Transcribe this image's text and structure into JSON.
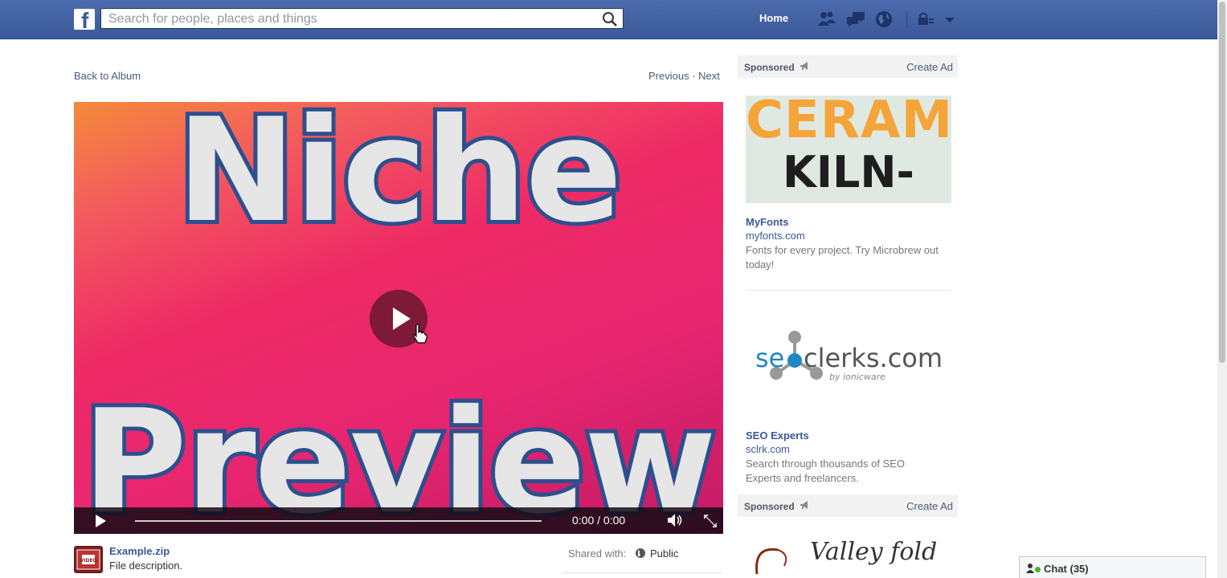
{
  "topbar": {
    "logo": "f",
    "search_placeholder": "Search for people, places and things",
    "home_label": "Home",
    "icons": [
      "friend-requests-icon",
      "messages-icon",
      "notifications-globe-icon",
      "privacy-shortcuts-icon",
      "account-dropdown-icon"
    ]
  },
  "nav": {
    "back_to_album": "Back to Album",
    "previous": "Previous",
    "separator": "·",
    "next": "Next"
  },
  "video": {
    "title_line_1": "Niche",
    "title_line_2": "Preview",
    "time": "0:00 / 0:00",
    "colors": {
      "outline": "#2d4f8e",
      "fill": "#e6e6e6"
    }
  },
  "file": {
    "name": "Example.zip",
    "description": "File description.",
    "shared_label": "Shared with:",
    "shared_value": "Public",
    "icon_label": "VIDEO"
  },
  "ads": {
    "header_1": {
      "label": "Sponsored",
      "create": "Create Ad"
    },
    "ad_1": {
      "image_line_1": "CERAMIC",
      "image_line_2": "KILN-FIRED",
      "title": "MyFonts",
      "domain": "myfonts.com",
      "text": "Fonts for every project. Try Microbrew out today!"
    },
    "ad_2": {
      "logo_text_1": "se",
      "logo_text_2": "clerks.com",
      "logo_byline": "by ionicware",
      "title": "SEO Experts",
      "domain": "sclrk.com",
      "text": "Search through thousands of SEO Experts and freelancers."
    },
    "header_2": {
      "label": "Sponsored",
      "create": "Create Ad"
    },
    "ad_3": {
      "logo_text": "Valley fold"
    }
  },
  "chat": {
    "label": "Chat (35)"
  }
}
